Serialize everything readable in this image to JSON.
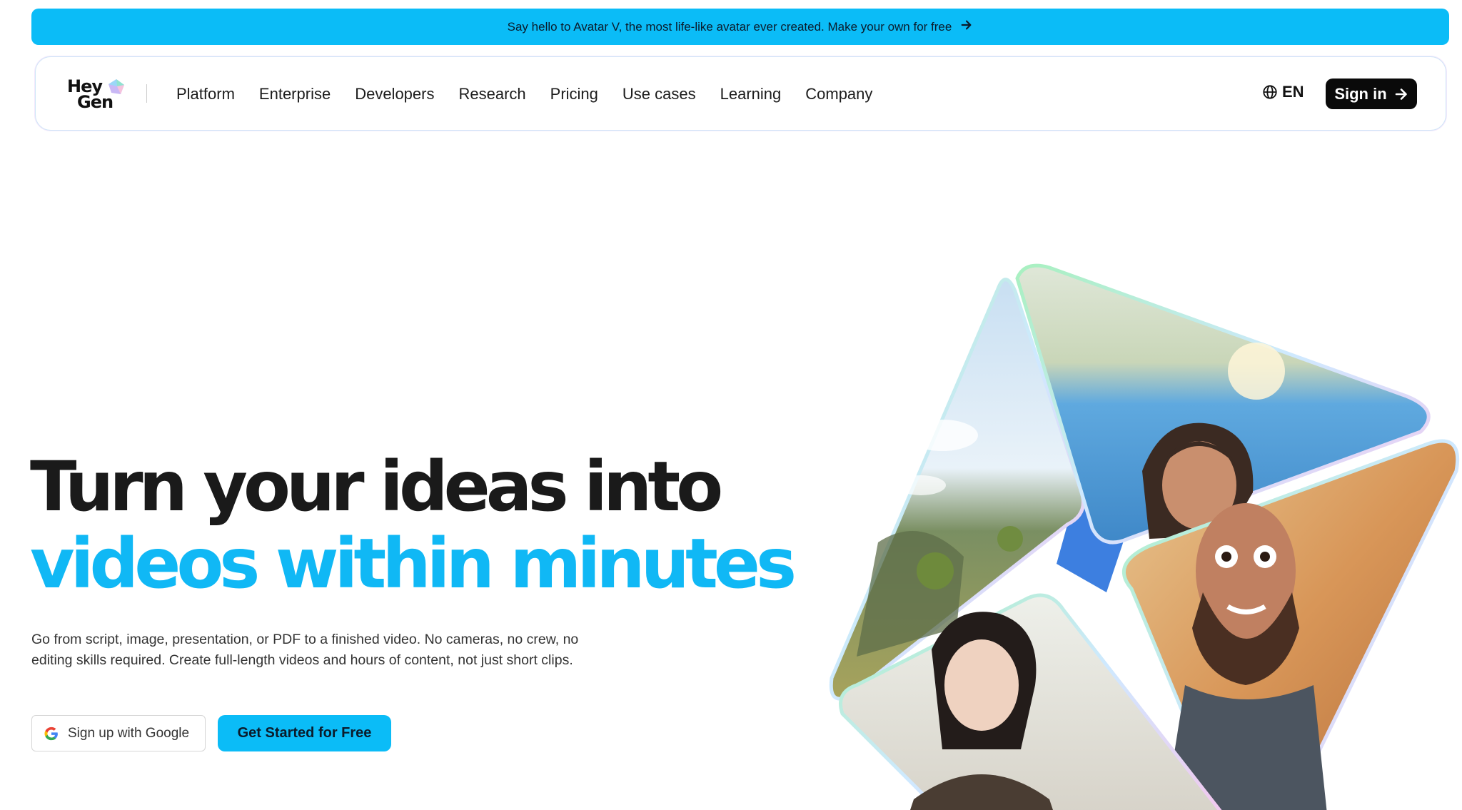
{
  "announcement": {
    "text": "Say hello to Avatar V, the most life-like avatar ever created. Make your own for free",
    "icon": "arrow-right-icon"
  },
  "nav": {
    "logo_line1": "Hey",
    "logo_line2": "Gen",
    "links": [
      "Platform",
      "Enterprise",
      "Developers",
      "Research",
      "Pricing",
      "Use cases",
      "Learning",
      "Company"
    ],
    "language": "EN",
    "language_icon": "globe-icon",
    "signin_label": "Sign in",
    "signin_icon": "arrow-right-icon"
  },
  "hero": {
    "headline_line1": "Turn your ideas into",
    "headline_line2": "videos within minutes",
    "subtext": "Go from script, image, presentation, or PDF to a finished video. No cameras, no crew, no editing skills required. Create full-length videos and hours of content, not just short clips.",
    "google_button_label": "Sign up with Google",
    "google_icon": "google-icon",
    "cta_label": "Get Started for Free"
  },
  "colors": {
    "accent": "#0bbcf7",
    "headline_accent": "#10b8f5",
    "dark": "#0a0a0a"
  }
}
